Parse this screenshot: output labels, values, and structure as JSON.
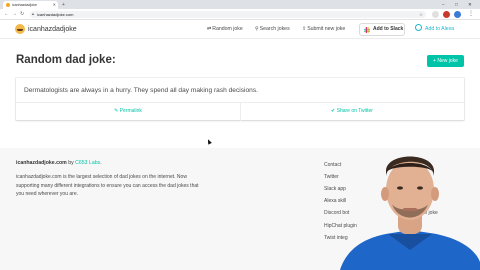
{
  "browser": {
    "tab_title": "icanhazdadjoke",
    "new_tab_symbol": "+",
    "url": "icanhazdadjoke.com",
    "window_controls": [
      "–",
      "□",
      "✕"
    ]
  },
  "nav": {
    "brand": "icanhazdadjoke",
    "links": [
      "Random joke",
      "Search jokes",
      "Submit new joke"
    ],
    "slack_button": "Add to Slack",
    "alexa_button": "Add to Alexa"
  },
  "main": {
    "title": "Random dad joke:",
    "new_joke_button": "New joke",
    "joke_text": "Dermatologists are always in a hurry. They spend all day making rash decisions.",
    "permalink_label": "Permalink",
    "twitter_label": "Share on Twitter"
  },
  "footer": {
    "site_name": "icanhazdadjoke.com",
    "by_text": "by",
    "by_link": "C653 Labs",
    "by_suffix": ".",
    "description": "icanhazdadjoke.com is the largest selection of dad jokes on the internet. Now supporting many different integrations to ensure you can access the dad jokes that you need wherever you are.",
    "links_col1": [
      "Contact",
      "Twitter",
      "Slack app",
      "Alexa skill",
      "Discord bot",
      "HipChat plugin",
      "Twist integ"
    ],
    "links_col2_partial": [
      "oke",
      "ke",
      "new joke"
    ]
  },
  "colors": {
    "accent": "#00c4a7",
    "alexa": "#1fb7c9",
    "footer_bg": "#f7f7f7"
  },
  "icons": [
    "favicon",
    "lock-icon",
    "star-icon",
    "logo-icon",
    "shuffle-icon",
    "search-icon",
    "share-icon",
    "slack-icon",
    "alexa-icon",
    "plus-icon",
    "link-icon",
    "twitter-icon"
  ]
}
